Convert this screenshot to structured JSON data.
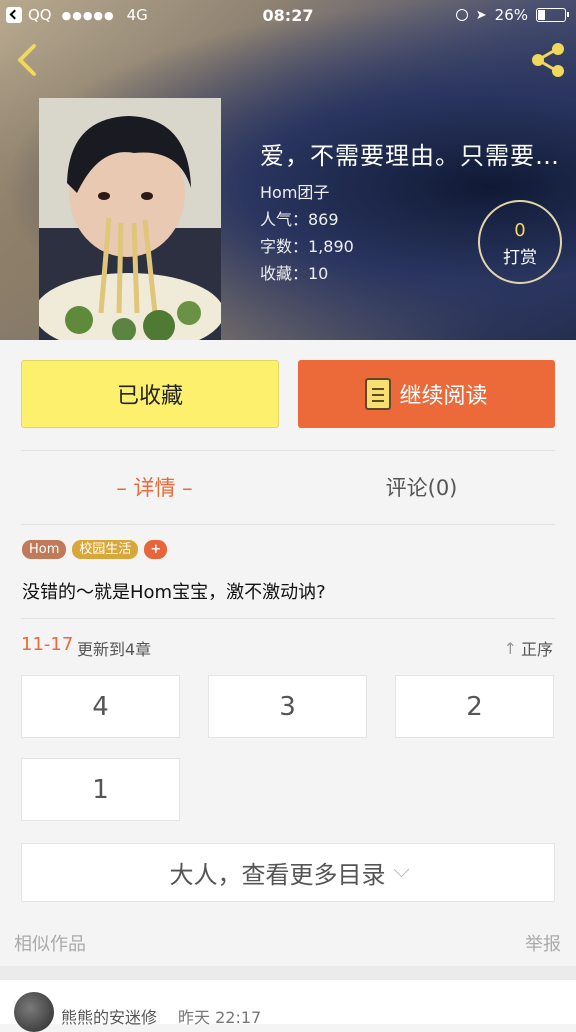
{
  "status_bar": {
    "carrier": "QQ",
    "signal": "●●●●●",
    "network": "4G",
    "time": "08:27",
    "battery": "26%"
  },
  "book": {
    "title": "爱，不需要理由。只需要…",
    "author": "Hom团子",
    "popularity": "人气：869",
    "words": "字数：1,890",
    "collects": "收藏：10",
    "tip_count": "0",
    "tip_label": "打赏"
  },
  "buttons": {
    "favorited": "已收藏",
    "continue_read": "继续阅读"
  },
  "tabs": {
    "detail": "– 详情 –",
    "comments": "评论(0)"
  },
  "tags": [
    "Hom",
    "校园生活",
    "+"
  ],
  "description": "没错的～就是Hom宝宝，激不激动讷?",
  "update": {
    "date": "11-17",
    "text": "更新到4章",
    "sort_label": "正序",
    "sort_icon": "↑"
  },
  "chapters": [
    "4",
    "3",
    "2",
    "1"
  ],
  "more_catalog": "大人，查看更多目录",
  "similar": "相似作品",
  "report": "举报",
  "comment": {
    "user": "熊熊的安迷修",
    "time": "昨天  22:17"
  },
  "colors": {
    "accent": "#ec693a",
    "favorite_bg": "#fdf06d",
    "tag_hom": "#c07a5a",
    "tag_campus": "#d9a63a"
  }
}
